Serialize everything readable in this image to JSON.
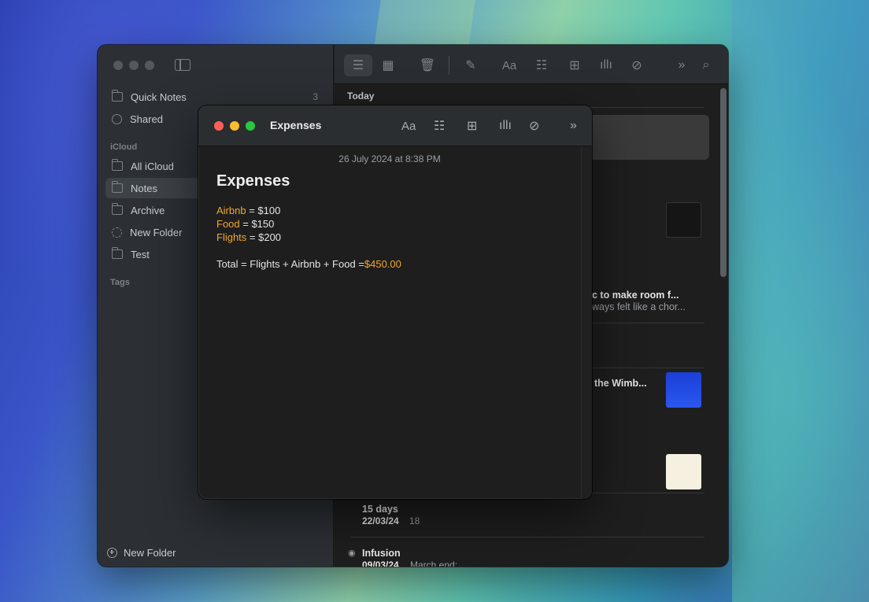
{
  "sidebar": {
    "items": [
      {
        "label": "Quick Notes",
        "count": "3"
      },
      {
        "label": "Shared"
      }
    ],
    "section_icloud": "iCloud",
    "folders": [
      {
        "label": "All iCloud"
      },
      {
        "label": "Notes"
      },
      {
        "label": "Archive"
      },
      {
        "label": "New Folder"
      },
      {
        "label": "Test"
      }
    ],
    "section_tags": "Tags",
    "new_folder_label": "New Folder"
  },
  "note_list": {
    "header_today": "Today",
    "peek": [
      {
        "title": "c to make room f...",
        "subtitle": "ways felt like a chor..."
      },
      {
        "title": "the Wimb..."
      },
      {
        "title": "15 days",
        "date": "22/03/24",
        "extra": "18"
      },
      {
        "title": "Infusion",
        "date": "09/03/24",
        "extra": "March end:"
      }
    ]
  },
  "note_window": {
    "title": "Expenses",
    "timestamp": "26 July 2024 at 8:38 PM",
    "heading": "Expenses",
    "lines": [
      {
        "label": "Airbnb",
        "text": " = $100"
      },
      {
        "label": "Food",
        "text": " = $150"
      },
      {
        "label": "Flights",
        "text": " = $200"
      }
    ],
    "total_text": "Total = Flights + Airbnb + Food  =",
    "total_value": "$450.00",
    "toolbar": {
      "format": "Aa"
    }
  },
  "main_toolbar": {
    "format": "Aa"
  },
  "colors": {
    "accent_orange": "#f0a733",
    "close": "#ff5f57",
    "minimize": "#febc2e",
    "maximize": "#28c840"
  }
}
